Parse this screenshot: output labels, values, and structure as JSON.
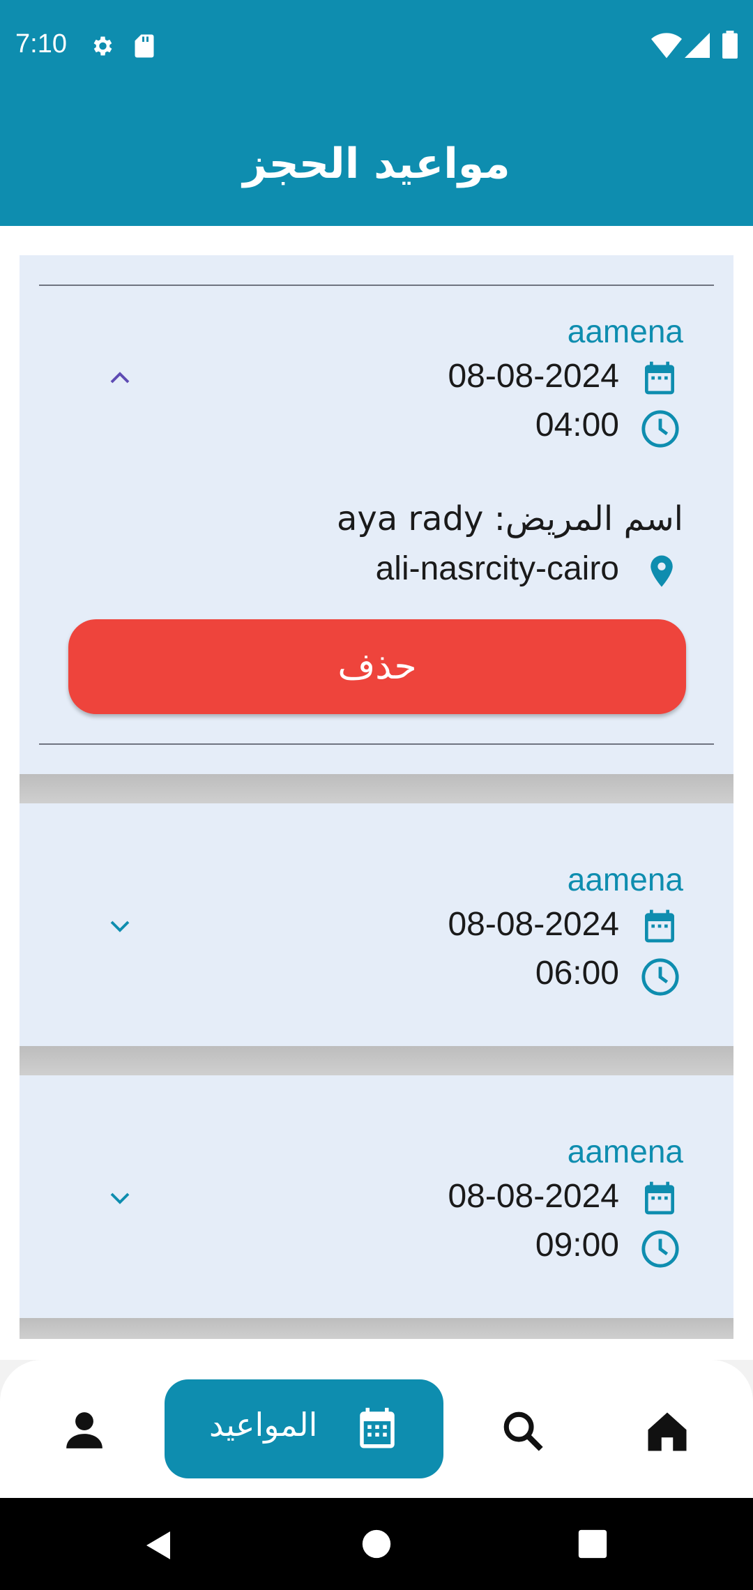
{
  "status_bar": {
    "time": "7:10"
  },
  "header": {
    "title": "مواعيد الحجز"
  },
  "appointments": [
    {
      "doctor": "aamena",
      "date": "08-08-2024",
      "time": "04:00",
      "expanded": true,
      "patient_line": "اسم المريض: aya rady",
      "address": "ali-nasrcity-cairo",
      "delete_label": "حذف"
    },
    {
      "doctor": "aamena",
      "date": "08-08-2024",
      "time": "06:00",
      "expanded": false
    },
    {
      "doctor": "aamena",
      "date": "08-08-2024",
      "time": "09:00",
      "expanded": false
    }
  ],
  "bottom_nav": {
    "appointments_label": "المواعيد",
    "items": [
      "profile-icon",
      "calendar-icon",
      "search-icon",
      "home-icon"
    ]
  },
  "colors": {
    "primary": "#0e8daf",
    "card_bg": "#e5edf8",
    "delete": "#ee443c"
  }
}
